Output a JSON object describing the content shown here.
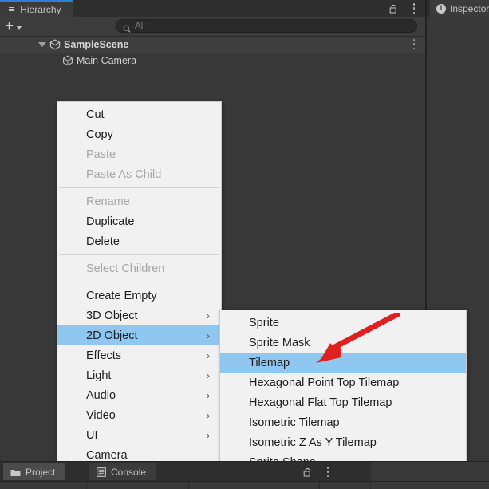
{
  "window": {
    "hierarchy_tab": {
      "label": "Hierarchy",
      "icon": "hierarchy-list-icon"
    },
    "inspector_tab": {
      "label": "Inspector",
      "icon": "info-icon"
    },
    "lock_icon": "lock-open-icon",
    "menu_icon": "kebab-menu-icon"
  },
  "toolbar": {
    "add_label": "+",
    "add_dropdown_icon": "chevron-down-icon",
    "search": {
      "icon": "search-icon",
      "placeholder": "All",
      "value": ""
    }
  },
  "hierarchy": {
    "rows": [
      {
        "label": "SampleScene",
        "icon": "scene-icon",
        "depth": 0,
        "expanded": true,
        "bold": true
      },
      {
        "label": "Main Camera",
        "icon": "cube-icon",
        "depth": 1,
        "expanded": false,
        "bold": false
      }
    ]
  },
  "context_menu": {
    "items": [
      {
        "label": "Cut",
        "disabled": false,
        "submenu": false,
        "highlight": false
      },
      {
        "label": "Copy",
        "disabled": false,
        "submenu": false,
        "highlight": false
      },
      {
        "label": "Paste",
        "disabled": true,
        "submenu": false,
        "highlight": false
      },
      {
        "label": "Paste As Child",
        "disabled": true,
        "submenu": false,
        "highlight": false
      },
      {
        "separator": true
      },
      {
        "label": "Rename",
        "disabled": true,
        "submenu": false,
        "highlight": false
      },
      {
        "label": "Duplicate",
        "disabled": false,
        "submenu": false,
        "highlight": false
      },
      {
        "label": "Delete",
        "disabled": false,
        "submenu": false,
        "highlight": false
      },
      {
        "separator": true
      },
      {
        "label": "Select Children",
        "disabled": true,
        "submenu": false,
        "highlight": false
      },
      {
        "separator": true
      },
      {
        "label": "Create Empty",
        "disabled": false,
        "submenu": false,
        "highlight": false
      },
      {
        "label": "3D Object",
        "disabled": false,
        "submenu": true,
        "highlight": false
      },
      {
        "label": "2D Object",
        "disabled": false,
        "submenu": true,
        "highlight": true
      },
      {
        "label": "Effects",
        "disabled": false,
        "submenu": true,
        "highlight": false
      },
      {
        "label": "Light",
        "disabled": false,
        "submenu": true,
        "highlight": false
      },
      {
        "label": "Audio",
        "disabled": false,
        "submenu": true,
        "highlight": false
      },
      {
        "label": "Video",
        "disabled": false,
        "submenu": true,
        "highlight": false
      },
      {
        "label": "UI",
        "disabled": false,
        "submenu": true,
        "highlight": false
      },
      {
        "label": "Camera",
        "disabled": false,
        "submenu": false,
        "highlight": false
      }
    ],
    "submenu_arrow": "›"
  },
  "submenu": {
    "parent": "2D Object",
    "items": [
      {
        "label": "Sprite",
        "highlight": false
      },
      {
        "label": "Sprite Mask",
        "highlight": false
      },
      {
        "label": "Tilemap",
        "highlight": true
      },
      {
        "label": "Hexagonal Point Top Tilemap",
        "highlight": false
      },
      {
        "label": "Hexagonal Flat Top Tilemap",
        "highlight": false
      },
      {
        "label": "Isometric Tilemap",
        "highlight": false
      },
      {
        "label": "Isometric Z As Y Tilemap",
        "highlight": false
      },
      {
        "label": "Sprite Shape",
        "highlight": false
      }
    ]
  },
  "annotation": {
    "arrow": "red-arrow-pointer",
    "points_to": "Tilemap",
    "color": "#e02020"
  },
  "bottom_tabs": [
    {
      "label": "Project",
      "icon": "folder-icon",
      "active": true
    },
    {
      "label": "Console",
      "icon": "console-icon",
      "active": false
    }
  ],
  "colors": {
    "editor_bg": "#383838",
    "panel_bg": "#3c3c3c",
    "tab_accent": "#2c80d8",
    "menu_bg": "#f1f1f1",
    "menu_highlight": "#8fc7f0",
    "annotation_red": "#e02020"
  }
}
